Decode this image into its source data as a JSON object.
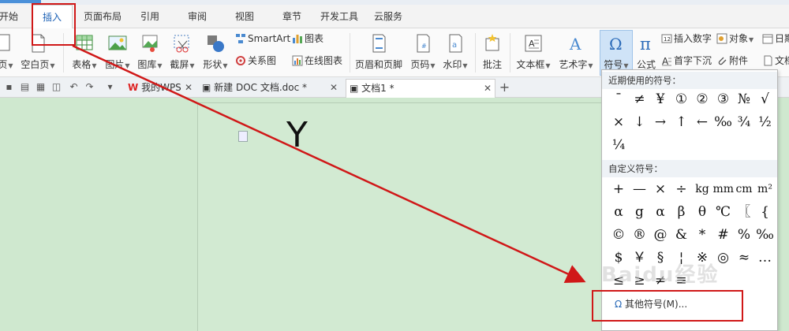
{
  "menu_tabs": [
    "开始",
    "插入",
    "页面布局",
    "引用",
    "审阅",
    "视图",
    "章节",
    "开发工具",
    "云服务"
  ],
  "ribbon": {
    "page_btn": "页",
    "blank_page": "空白页",
    "table": "表格",
    "picture": "图片",
    "gallery": "图库",
    "screenshot": "截屏",
    "shape": "形状",
    "smartart": "SmartArt",
    "chart": "图表",
    "relation": "关系图",
    "online_chart": "在线图表",
    "header_footer": "页眉和页脚",
    "page_number": "页码",
    "watermark": "水印",
    "comment": "批注",
    "textbox": "文本框",
    "wordart": "艺术字",
    "symbol": "符号",
    "formula": "公式",
    "insert_number": "插入数字",
    "object": "对象",
    "date": "日期",
    "drop_cap": "首字下沉",
    "attachment": "附件",
    "document": "文档"
  },
  "doc_tabs": [
    {
      "label": "我的WPS"
    },
    {
      "label": "新建 DOC 文档.doc *"
    },
    {
      "label": "文档1 *"
    }
  ],
  "document": {
    "text": "Y"
  },
  "symbol_panel": {
    "recent_title": "近期使用的符号：",
    "recent": [
      "¯",
      "≠",
      "¥",
      "①",
      "②",
      "③",
      "№",
      "√",
      "×",
      "↓",
      "→",
      "↑",
      "←",
      "‰",
      "¾",
      "½",
      "¼"
    ],
    "custom_title": "自定义符号：",
    "custom": [
      "+",
      "—",
      "×",
      "÷",
      "kg",
      "mm",
      "cm",
      "m²",
      "α",
      "g",
      "α",
      "β",
      "θ",
      "℃",
      "〖",
      "{",
      "©",
      "®",
      "@",
      "&",
      "*",
      "#",
      "%",
      "‰",
      "$",
      "￥",
      "§",
      "¦",
      "※",
      "◎",
      "≈",
      "…",
      "≤",
      "≥",
      "≠",
      "≡"
    ],
    "more_label": "其他符号(M)..."
  },
  "watermark_text": "Baidu经验",
  "colors": {
    "accent": "#1a5fb4",
    "highlight_red": "#d01818",
    "doc_bg": "#cfe8cf"
  }
}
